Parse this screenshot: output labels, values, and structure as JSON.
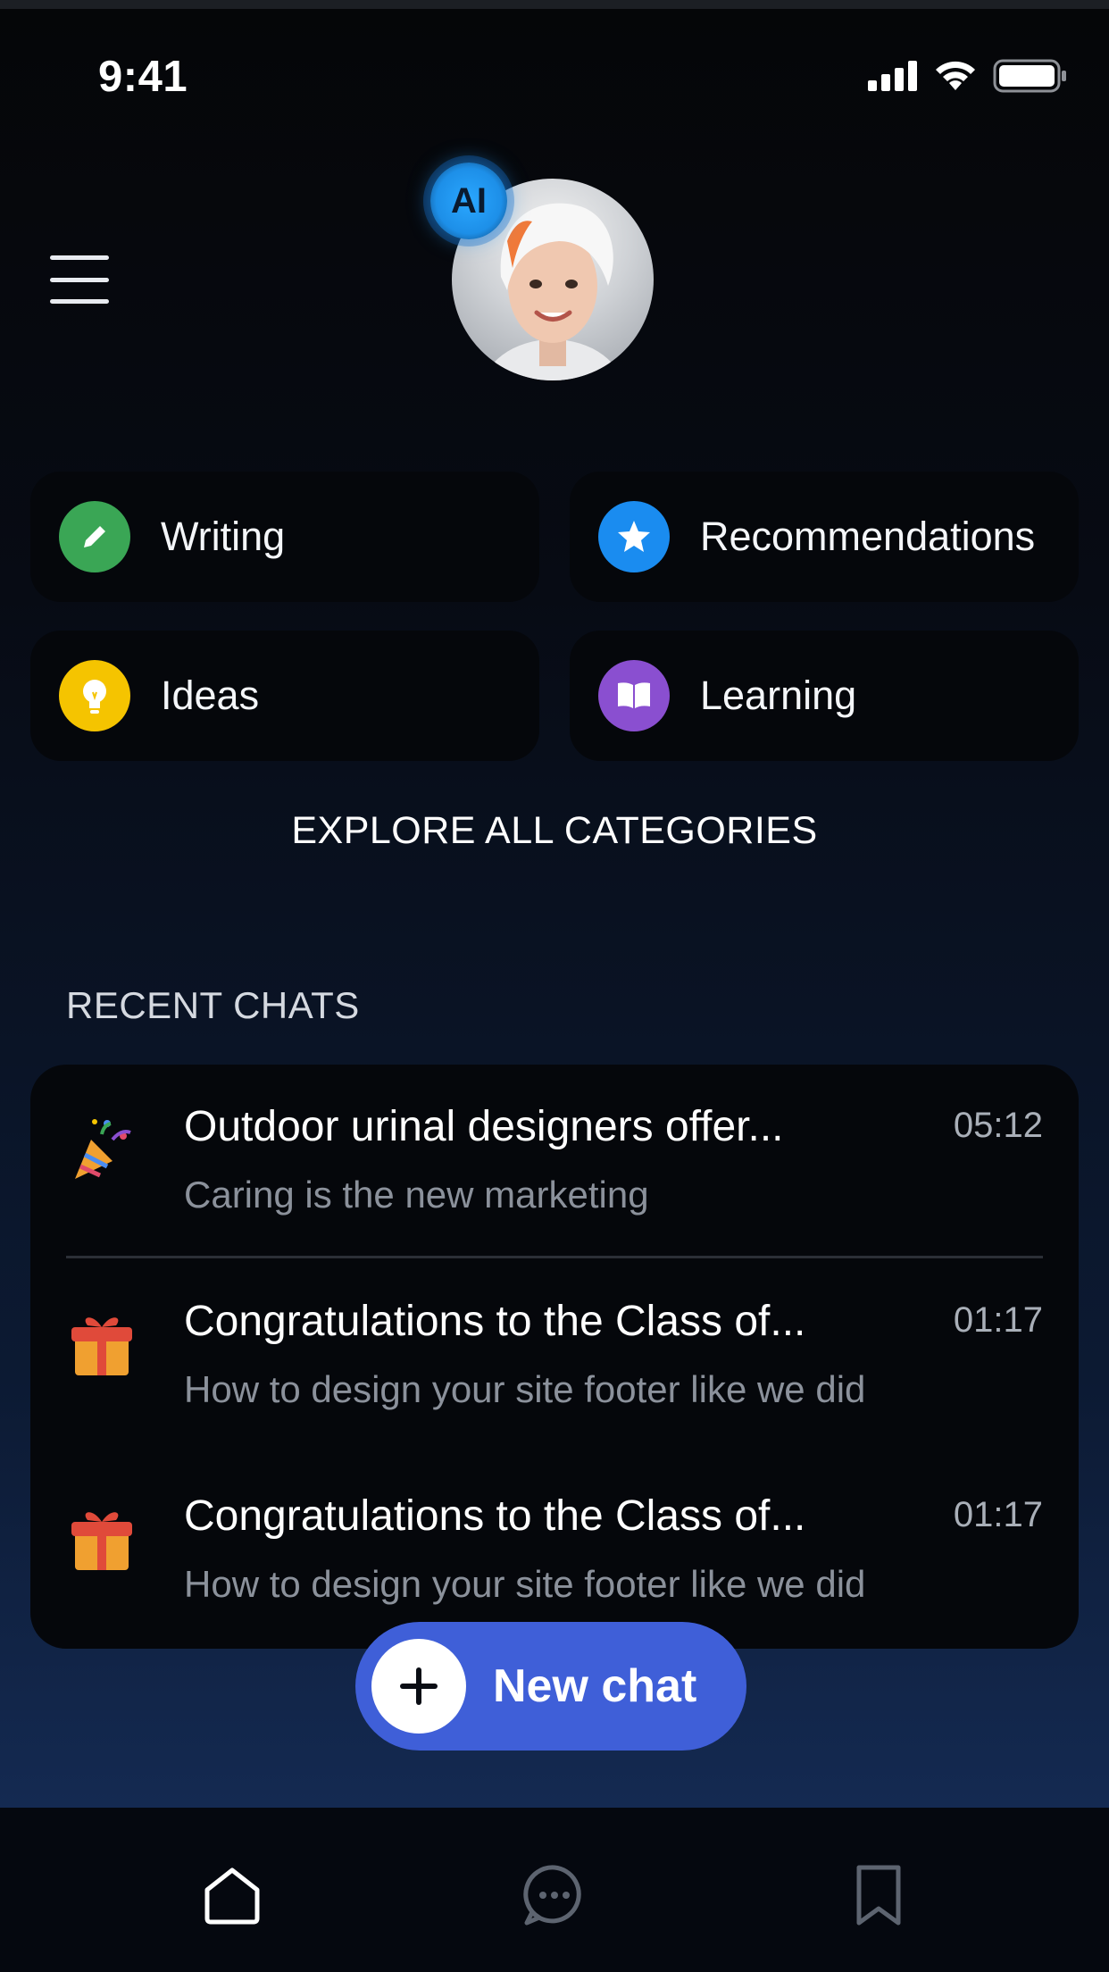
{
  "status_bar": {
    "time": "9:41",
    "icons": [
      "signal-icon",
      "wifi-icon",
      "battery-icon"
    ]
  },
  "header": {
    "menu_icon": "hamburger-menu-icon",
    "avatar_badge": "AI",
    "avatar": "ai-assistant-avatar"
  },
  "categories": [
    {
      "label": "Writing",
      "icon": "pencil-icon",
      "color": "#3aa655"
    },
    {
      "label": "Recommendations",
      "icon": "star-icon",
      "color": "#1a8cf0"
    },
    {
      "label": "Ideas",
      "icon": "lightbulb-icon",
      "color": "#f5c400"
    },
    {
      "label": "Learning",
      "icon": "book-icon",
      "color": "#8a4fd0"
    }
  ],
  "explore_label": "EXPLORE ALL CATEGORIES",
  "recent_chats": {
    "title": "RECENT CHATS",
    "items": [
      {
        "emoji": "party-popper-icon",
        "title": "Outdoor urinal designers offer...",
        "subtitle": "Caring is the new marketing",
        "time": "05:12"
      },
      {
        "emoji": "gift-icon",
        "title": "Congratulations to the Class of...",
        "subtitle": "How to design your site footer like we did",
        "time": "01:17"
      },
      {
        "emoji": "gift-icon",
        "title": "Congratulations to the Class of...",
        "subtitle": "How to design your site footer like we did",
        "time": "01:17"
      }
    ]
  },
  "new_chat": {
    "label": "New chat",
    "icon": "plus-icon",
    "color": "#3f5fd8"
  },
  "bottom_nav": [
    {
      "icon": "home-icon",
      "active": true
    },
    {
      "icon": "chat-bubble-icon",
      "active": false
    },
    {
      "icon": "bookmark-icon",
      "active": false
    }
  ]
}
